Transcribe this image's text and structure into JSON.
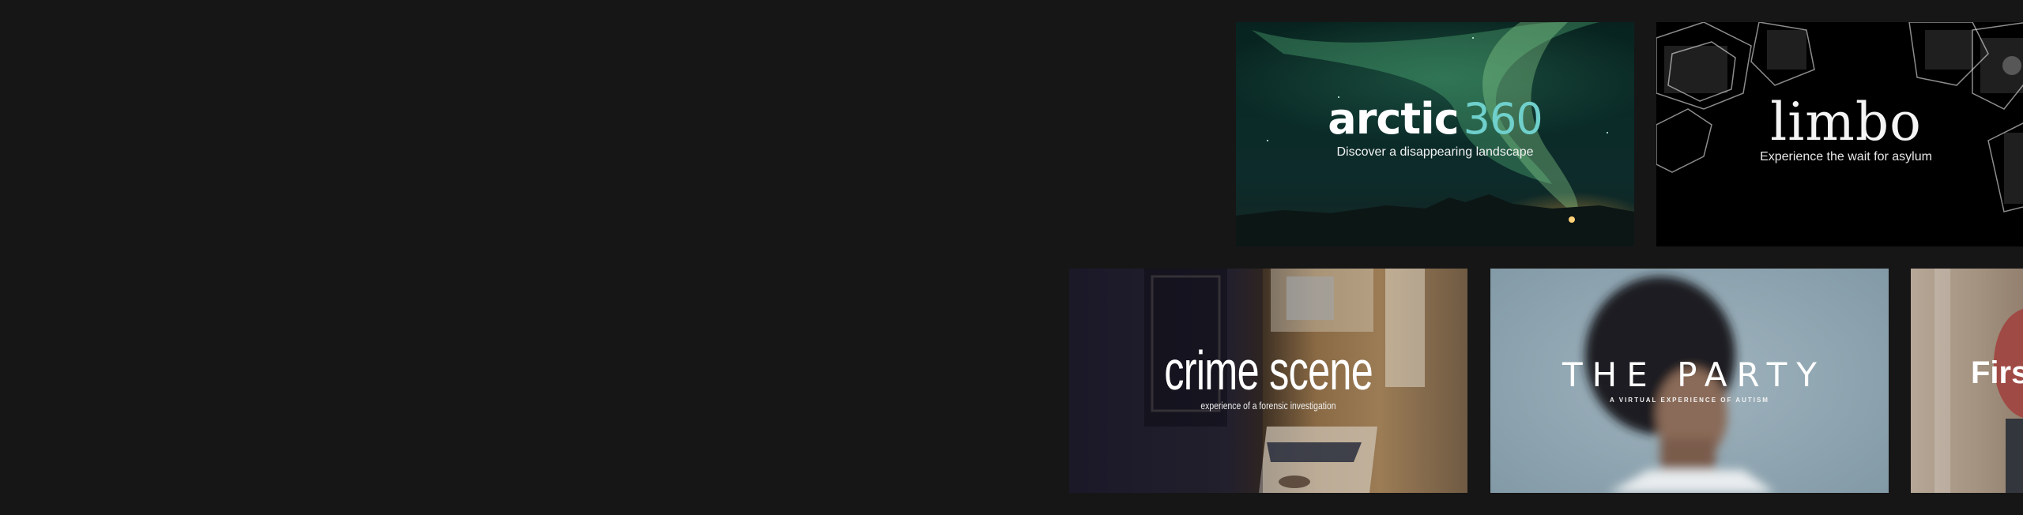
{
  "tiles": [
    {
      "id": "arctic360",
      "title_bold": "arctic",
      "title_light": "360",
      "subtitle": "Discover a disappearing landscape",
      "accent_color": "#6fd0cc"
    },
    {
      "id": "limbo",
      "title": "limbo",
      "subtitle": "Experience the wait for asylum"
    },
    {
      "id": "crime-scene",
      "title": "crime scene",
      "subtitle": "experience of a forensic investigation"
    },
    {
      "id": "the-party",
      "title": "THE PARTY",
      "subtitle": "A VIRTUAL EXPERIENCE OF AUTISM"
    },
    {
      "id": "first-partial",
      "title": "Firs"
    }
  ],
  "colors": {
    "page_background": "#161616"
  }
}
